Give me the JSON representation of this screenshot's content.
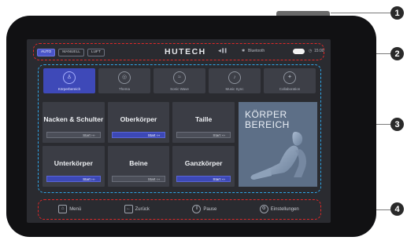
{
  "status_bar": {
    "modes": [
      "AUTO",
      "MANUELL",
      "LUFT"
    ],
    "active_mode": "AUTO",
    "brand": "HUTECH",
    "volume_label": "◀ ▌▌",
    "bluetooth_label": "Bluetooth",
    "time": "15:00"
  },
  "tabs": [
    {
      "label": "Körperbereich",
      "icon": "body-icon"
    },
    {
      "label": "Thema",
      "icon": "theme-icon"
    },
    {
      "label": "Sonic Wave",
      "icon": "wave-icon"
    },
    {
      "label": "Music Sync",
      "icon": "music-icon"
    },
    {
      "label": "Collaboration",
      "icon": "collab-icon"
    }
  ],
  "grid": [
    {
      "label": "Nacken & Schulter",
      "button": "Start"
    },
    {
      "label": "Oberkörper",
      "button": "Start"
    },
    {
      "label": "Taille",
      "button": "Start"
    },
    {
      "label": "Unterkörper",
      "button": "Start"
    },
    {
      "label": "Beine",
      "button": "Start"
    },
    {
      "label": "Ganzkörper",
      "button": "Start"
    }
  ],
  "feature_panel": {
    "line1": "KÖRPER",
    "line2": "BEREICH"
  },
  "bottom_nav": [
    {
      "label": "Menü",
      "icon": "home-icon"
    },
    {
      "label": "Zurück",
      "icon": "back-icon"
    },
    {
      "label": "Pause",
      "icon": "pause-icon"
    },
    {
      "label": "Einstellungen",
      "icon": "settings-icon"
    }
  ],
  "callouts": [
    "1",
    "2",
    "3",
    "4"
  ],
  "colors": {
    "accent": "#3e49b8",
    "callout_red": "#e02828",
    "callout_blue": "#2fa6e8",
    "bezel": "#111113"
  }
}
